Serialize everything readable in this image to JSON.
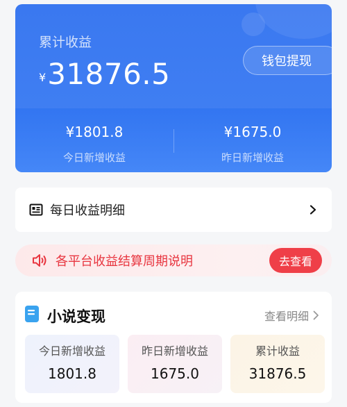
{
  "earnings": {
    "total_label": "累计收益",
    "currency_symbol": "¥",
    "total_amount": "31876.5",
    "withdraw_label": "钱包提现",
    "today_value": "¥1801.8",
    "today_label": "今日新增收益",
    "yesterday_value": "¥1675.0",
    "yesterday_label": "昨日新增收益"
  },
  "daily_detail": {
    "label": "每日收益明细",
    "icon": "ledger-icon"
  },
  "notice": {
    "text": "各平台收益结算周期说明",
    "button_label": "去查看",
    "icon": "speaker-icon"
  },
  "novel": {
    "title": "小说变现",
    "link_label": "查看明细",
    "tiles": [
      {
        "label": "今日新增收益",
        "value": "1801.8"
      },
      {
        "label": "昨日新增收益",
        "value": "1675.0"
      },
      {
        "label": "累计收益",
        "value": "31876.5"
      }
    ]
  },
  "colors": {
    "accent_blue": "#3f7ef2",
    "alert_red": "#ef3f48"
  }
}
